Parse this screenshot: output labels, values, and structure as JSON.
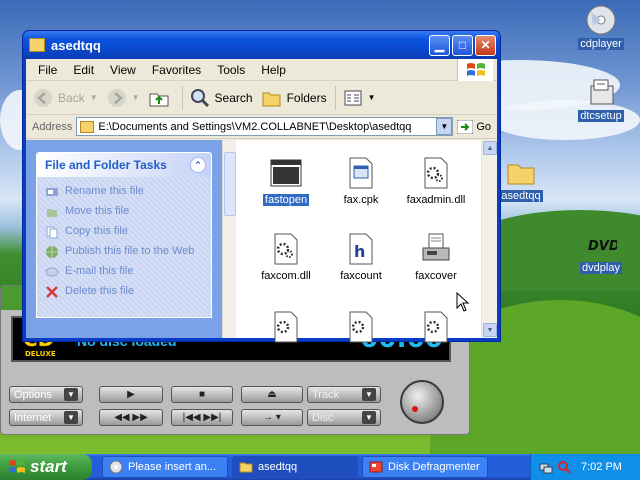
{
  "desktop": {
    "icons": [
      {
        "id": "cdplayer",
        "label": "cdplayer"
      },
      {
        "id": "dtcsetup",
        "label": "dtcsetup"
      },
      {
        "id": "asedtqq",
        "label": "asedtqq"
      },
      {
        "id": "dvdplay",
        "label": "dvdplay"
      }
    ]
  },
  "window": {
    "title": "asedtqq",
    "menu": [
      "File",
      "Edit",
      "View",
      "Favorites",
      "Tools",
      "Help"
    ],
    "toolbar": {
      "back": "Back",
      "search": "Search",
      "folders": "Folders"
    },
    "address": {
      "label": "Address",
      "value": "E:\\Documents and Settings\\VM2.COLLABNET\\Desktop\\asedtqq",
      "go": "Go"
    },
    "taskpane": {
      "title": "File and Folder Tasks",
      "tasks": [
        "Rename this file",
        "Move this file",
        "Copy this file",
        "Publish this file to the Web",
        "E-mail this file",
        "Delete this file"
      ]
    },
    "files": [
      {
        "name": "fastopen",
        "selected": true,
        "icon": "blank-app-icon"
      },
      {
        "name": "fax.cpk",
        "selected": false,
        "icon": "window-file-icon"
      },
      {
        "name": "faxadmin.dll",
        "selected": false,
        "icon": "gear-file-icon"
      },
      {
        "name": "faxcom.dll",
        "selected": false,
        "icon": "gear-file-icon"
      },
      {
        "name": "faxcount",
        "selected": false,
        "icon": "h-file-icon"
      },
      {
        "name": "faxcover",
        "selected": false,
        "icon": "fax-machine-icon"
      },
      {
        "name": "",
        "selected": false,
        "icon": "gear-file-icon"
      },
      {
        "name": "",
        "selected": false,
        "icon": "gear-file-icon"
      },
      {
        "name": "",
        "selected": false,
        "icon": "gear-file-icon"
      }
    ]
  },
  "cdplayer": {
    "status": "No disc loaded",
    "time": "00:00",
    "options": "Options",
    "internet": "Internet",
    "track": "Track",
    "disc": "Disc"
  },
  "taskbar": {
    "start": "start",
    "tasks": [
      {
        "label": "Please insert an...",
        "active": false
      },
      {
        "label": "asedtqq",
        "active": true
      },
      {
        "label": "Disk Defragmenter",
        "active": false
      }
    ],
    "clock": "7:02 PM"
  },
  "colors": {
    "accent": "#245edb",
    "lcd_text": "#23b8f2",
    "selection": "#316ac5"
  }
}
